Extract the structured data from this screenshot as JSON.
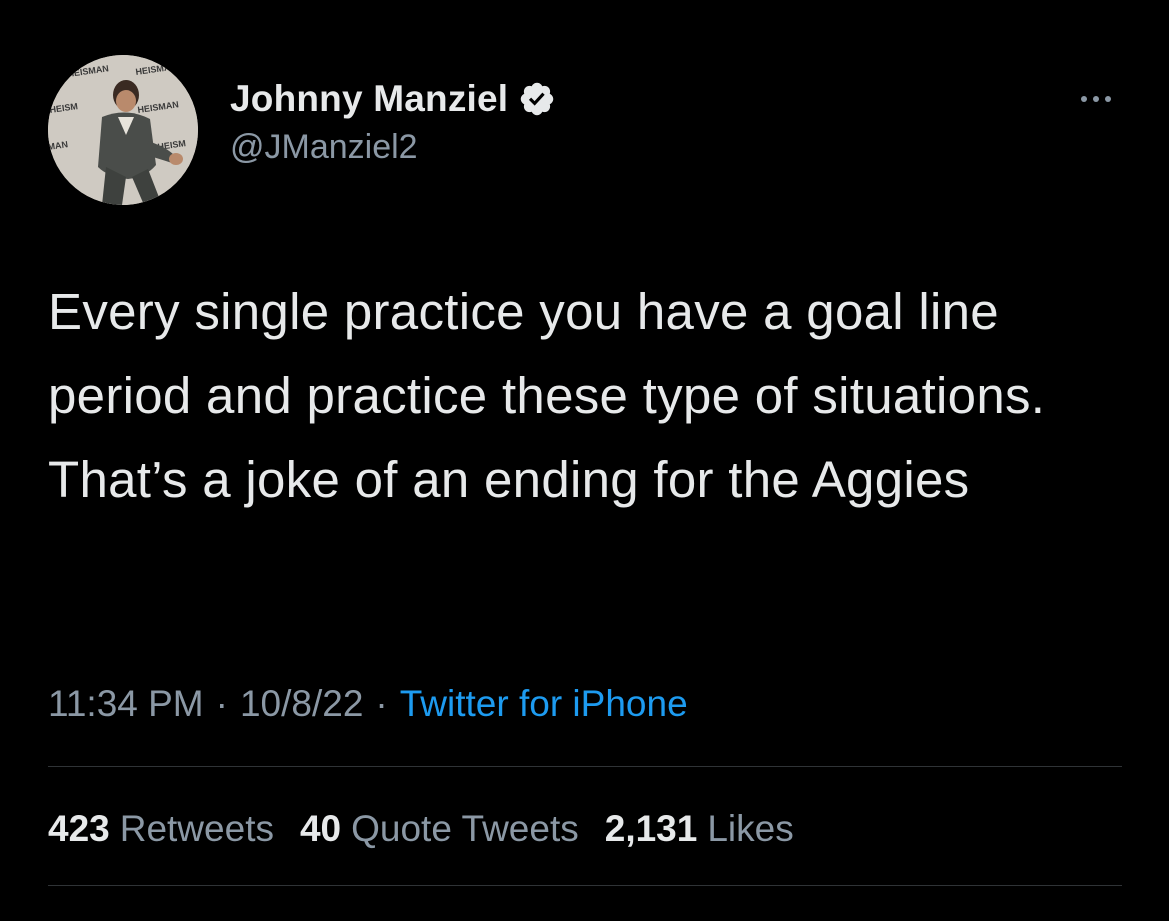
{
  "author": {
    "name": "Johnny Manziel",
    "handle": "@JManziel2",
    "verified": true,
    "avatar_icon": "profile-photo-heisman-backdrop"
  },
  "tweet": {
    "text": "Every single practice you have a goal line period and practice these type of situations. That’s a joke of an ending for the Aggies",
    "time": "11:34 PM",
    "date": "10/8/22",
    "separator": "·",
    "source": "Twitter for iPhone"
  },
  "stats": {
    "retweets_count": "423",
    "retweets_label": "Retweets",
    "quotes_count": "40",
    "quotes_label": "Quote Tweets",
    "likes_count": "2,131",
    "likes_label": "Likes"
  },
  "colors": {
    "background": "#000000",
    "primary_text": "#e7e9ea",
    "secondary_text": "#8b98a5",
    "link": "#1d9bf0",
    "divider": "#2f3336"
  },
  "icons": {
    "verified": "verified-badge-icon",
    "more": "more-options-icon"
  }
}
